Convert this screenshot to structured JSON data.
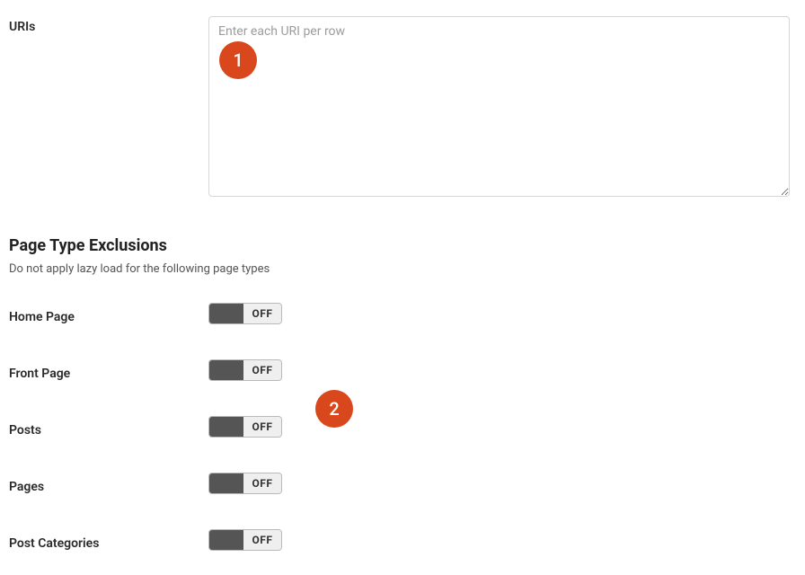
{
  "uris": {
    "label": "URIs",
    "placeholder": "Enter each URI per row",
    "value": ""
  },
  "section": {
    "heading": "Page Type Exclusions",
    "sub": "Do not apply lazy load for the following page types"
  },
  "toggles": [
    {
      "label": "Home Page",
      "state": "OFF"
    },
    {
      "label": "Front Page",
      "state": "OFF"
    },
    {
      "label": "Posts",
      "state": "OFF"
    },
    {
      "label": "Pages",
      "state": "OFF"
    },
    {
      "label": "Post Categories",
      "state": "OFF"
    }
  ],
  "annotations": {
    "badge1": "1",
    "badge2": "2"
  }
}
